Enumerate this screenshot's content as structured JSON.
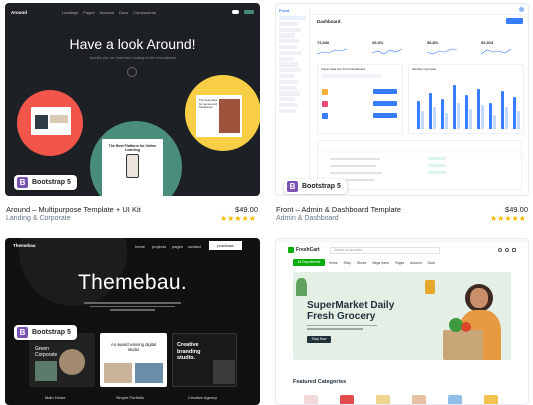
{
  "cards": [
    {
      "title": "Around – Multipurpose Template + UI Kit",
      "category": "Landing & Corporate",
      "price": "$49.00",
      "stars": "★★★★★",
      "badge": "Bootstrap 5",
      "preview": {
        "heading": "Have a look Around!",
        "logo": "Around",
        "nav": [
          "Landings",
          "Pages",
          "Account",
          "Docs",
          "Components"
        ],
        "subtext": "Just like you, we have been looking for the best solution",
        "inner1": "The best place for remote and freelancers",
        "inner2": "The Best Platform for Online Learning"
      }
    },
    {
      "title": "Front – Admin & Dashboard Template",
      "category": "Admin & Dashboard",
      "price": "$49.00",
      "stars": "★★★★★",
      "badge": "Bootstrap 5",
      "preview": {
        "logo": "Front",
        "heading": "Dashboard",
        "stats": [
          "72,540",
          "29.4%",
          "56.8%",
          "92,913"
        ],
        "panel1": "Import data into Front Dashboard",
        "panel2": "Monthly expenses"
      }
    },
    {
      "title": "",
      "category": "",
      "price": "",
      "stars": "",
      "badge": "Bootstrap 5",
      "preview": {
        "logo": "Themebau",
        "word": "Themebau.",
        "nav": [
          "home",
          "projects",
          "pages",
          "contact"
        ],
        "nav_button": "purchase",
        "tiles": [
          "Main Home",
          "Simple Portfolio",
          "Creative Agency"
        ],
        "tile_titles": [
          "Green Corporate",
          "An award winning digital studio",
          "Creative branding studio."
        ]
      }
    },
    {
      "title": "",
      "category": "",
      "price": "",
      "stars": "",
      "badge": "",
      "preview": {
        "logo": "FreshCart",
        "search_placeholder": "Search for products",
        "nav_button": "All Departments",
        "nav": [
          "Home",
          "Shop",
          "Stores",
          "Mega menu",
          "Pages",
          "Account",
          "Docs"
        ],
        "hero_title": "SuperMarket Daily Fresh Grocery",
        "hero_cta": "Shop Now",
        "section": "Featured Categories"
      }
    }
  ],
  "colors": {
    "star": "#f5b800",
    "bootstrap": "#7952b3",
    "front_blue": "#377dff",
    "fresh_green": "#0aad0a"
  }
}
